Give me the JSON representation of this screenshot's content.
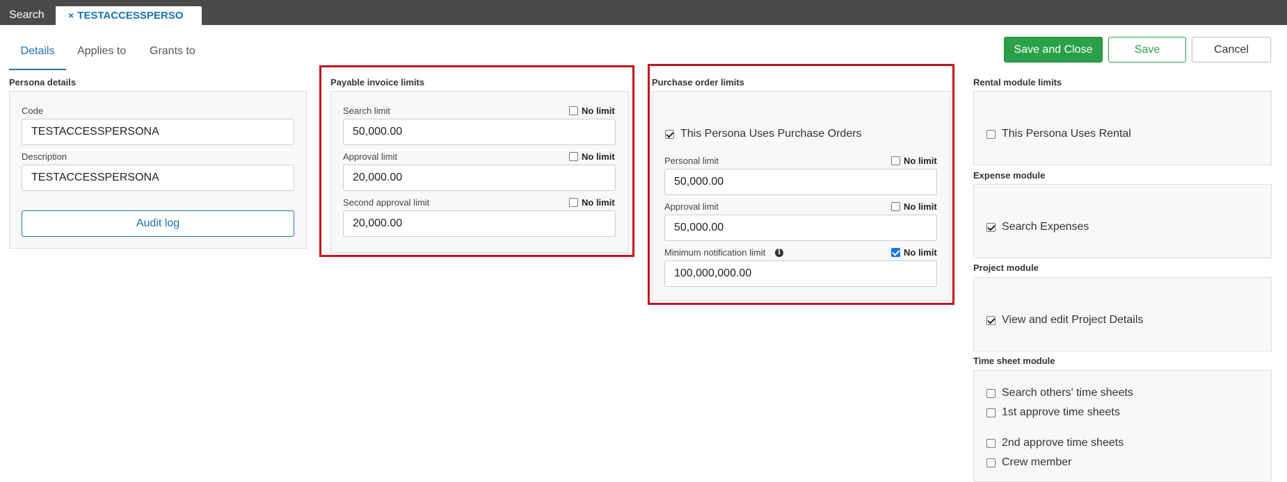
{
  "topbar": {
    "search_label": "Search",
    "doc_tab_close": "×",
    "doc_tab_label": "TESTACCESSPERSO"
  },
  "tabs": [
    {
      "label": "Details",
      "active": true
    },
    {
      "label": "Applies to",
      "active": false
    },
    {
      "label": "Grants to",
      "active": false
    }
  ],
  "actions": {
    "save_close": "Save and Close",
    "save": "Save",
    "cancel": "Cancel"
  },
  "persona": {
    "title": "Persona details",
    "code_label": "Code",
    "code_value": "TESTACCESSPERSONA",
    "description_label": "Description",
    "description_value": "TESTACCESSPERSONA",
    "audit_log": "Audit log"
  },
  "payable": {
    "title": "Payable invoice limits",
    "no_limit": "No limit",
    "search_label": "Search limit",
    "search_value": "50,000.00",
    "approval_label": "Approval limit",
    "approval_value": "20,000.00",
    "second_label": "Second approval limit",
    "second_value": "20,000.00"
  },
  "purchase": {
    "title": "Purchase order limits",
    "uses_po": "This Persona Uses Purchase Orders",
    "no_limit": "No limit",
    "personal_label": "Personal limit",
    "personal_value": "50,000.00",
    "approval_label": "Approval limit",
    "approval_value": "50,000.00",
    "min_notify_label": "Minimum notification limit",
    "min_notify_value": "100,000,000.00",
    "info_glyph": "i"
  },
  "rental": {
    "title": "Rental module limits",
    "uses_rental": "This Persona Uses Rental"
  },
  "expense": {
    "title": "Expense module",
    "search_expenses": "Search Expenses"
  },
  "project": {
    "title": "Project module",
    "view_edit": "View and edit Project Details"
  },
  "timesheet": {
    "title": "Time sheet module",
    "search_others": "Search others' time sheets",
    "first_approve": "1st approve time sheets",
    "second_approve": "2nd approve time sheets",
    "crew_member": "Crew member"
  }
}
